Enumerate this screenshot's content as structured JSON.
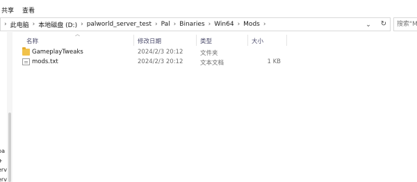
{
  "ribbon": {
    "menu": [
      "共享",
      "查看"
    ]
  },
  "address": {
    "crumbs": [
      "此电脑",
      "本地磁盘 (D:)",
      "palworld_server_test",
      "Pal",
      "Binaries",
      "Win64",
      "Mods"
    ],
    "separator": "›"
  },
  "search": {
    "placeholder": "搜索\"Mods\""
  },
  "nav_fragments": [
    "pa",
    "+",
    "erv",
    "erv"
  ],
  "columns": {
    "name": "名称",
    "date": "修改日期",
    "type": "类型",
    "size": "大小"
  },
  "files": [
    {
      "name": "GameplayTweaks",
      "date": "2024/2/3 20:12",
      "type": "文件夹",
      "size": "",
      "kind": "folder"
    },
    {
      "name": "mods.txt",
      "date": "2024/2/3 20:12",
      "type": "文本文档",
      "size": "1 KB",
      "kind": "file"
    }
  ]
}
